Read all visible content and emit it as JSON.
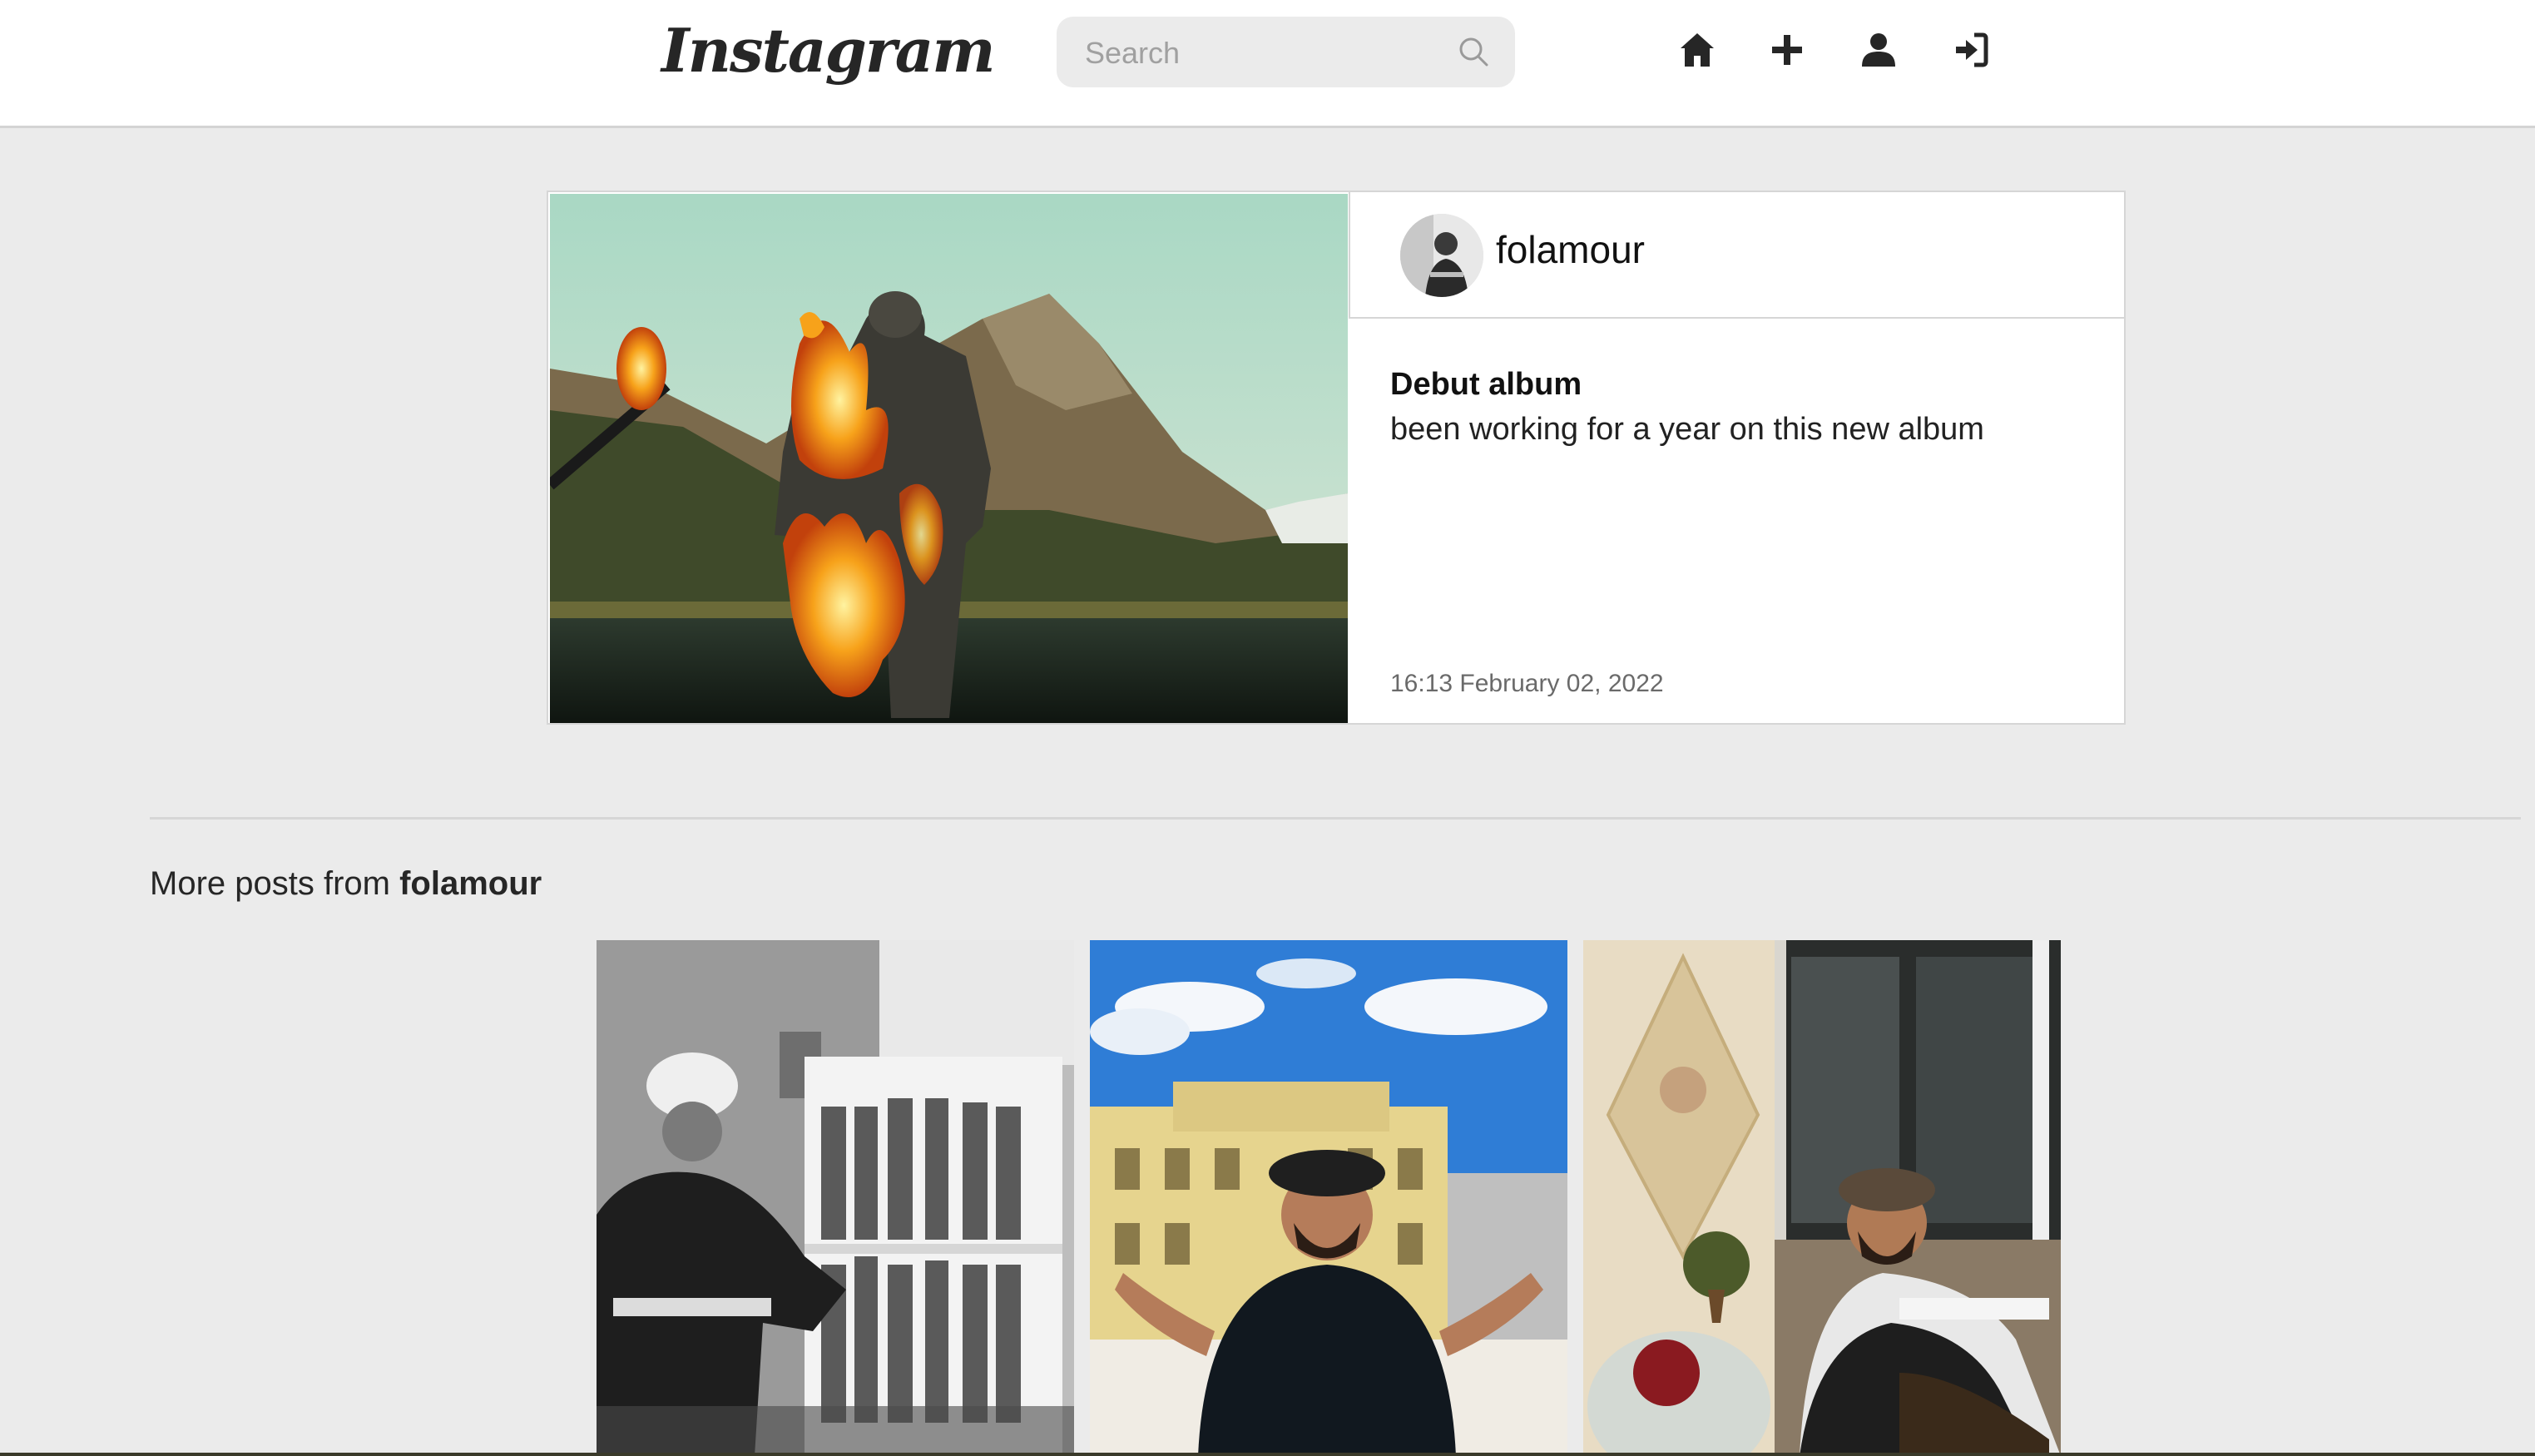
{
  "header": {
    "logo_text": "Instagram",
    "search_placeholder": "Search",
    "search_value": "",
    "nav": [
      {
        "name": "home-icon",
        "label": "Home"
      },
      {
        "name": "plus-icon",
        "label": "New post"
      },
      {
        "name": "user-icon",
        "label": "Profile"
      },
      {
        "name": "sign-in-icon",
        "label": "Log in"
      }
    ]
  },
  "post": {
    "username": "folamour",
    "title": "Debut album",
    "caption": "been working for a year on this new album",
    "timestamp": "16:13 February 02, 2022"
  },
  "more": {
    "heading_prefix": "More posts from ",
    "heading_user": "folamour"
  },
  "colors": {
    "background": "#ebebeb",
    "header": "#ffffff",
    "text": "#262626",
    "muted": "#6a6a6a"
  }
}
